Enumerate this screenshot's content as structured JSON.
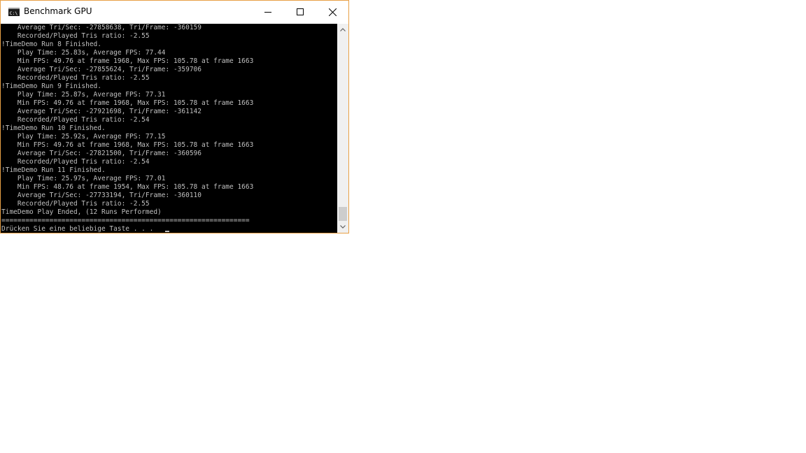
{
  "window": {
    "title": "Benchmark GPU",
    "icon": "cmd-icon",
    "border_color": "#e8a046"
  },
  "controls": {
    "minimize_icon": "minimize-icon",
    "maximize_icon": "maximize-icon",
    "close_icon": "close-icon"
  },
  "console": {
    "background": "#000000",
    "text_color": "#c0c0c0",
    "lines": [
      "    Average Tri/Sec: -27858638, Tri/Frame: -360159",
      "    Recorded/Played Tris ratio: -2.55",
      "!TimeDemo Run 8 Finished.",
      "    Play Time: 25.83s, Average FPS: 77.44",
      "    Min FPS: 49.76 at frame 1968, Max FPS: 105.78 at frame 1663",
      "    Average Tri/Sec: -27855624, Tri/Frame: -359706",
      "    Recorded/Played Tris ratio: -2.55",
      "!TimeDemo Run 9 Finished.",
      "    Play Time: 25.87s, Average FPS: 77.31",
      "    Min FPS: 49.76 at frame 1968, Max FPS: 105.78 at frame 1663",
      "    Average Tri/Sec: -27921698, Tri/Frame: -361142",
      "    Recorded/Played Tris ratio: -2.54",
      "!TimeDemo Run 10 Finished.",
      "    Play Time: 25.92s, Average FPS: 77.15",
      "    Min FPS: 49.76 at frame 1968, Max FPS: 105.78 at frame 1663",
      "    Average Tri/Sec: -27821500, Tri/Frame: -360596",
      "    Recorded/Played Tris ratio: -2.54",
      "!TimeDemo Run 11 Finished.",
      "    Play Time: 25.97s, Average FPS: 77.01",
      "    Min FPS: 48.76 at frame 1954, Max FPS: 105.78 at frame 1663",
      "    Average Tri/Sec: -27733194, Tri/Frame: -360110",
      "    Recorded/Played Tris ratio: -2.55",
      "TimeDemo Play Ended, (12 Runs Performed)",
      "==============================================================",
      "Drücken Sie eine beliebige Taste . . . "
    ]
  },
  "scrollbar": {
    "up_icon": "scroll-up-arrow-icon",
    "down_icon": "scroll-down-arrow-icon",
    "position": 0.93
  }
}
